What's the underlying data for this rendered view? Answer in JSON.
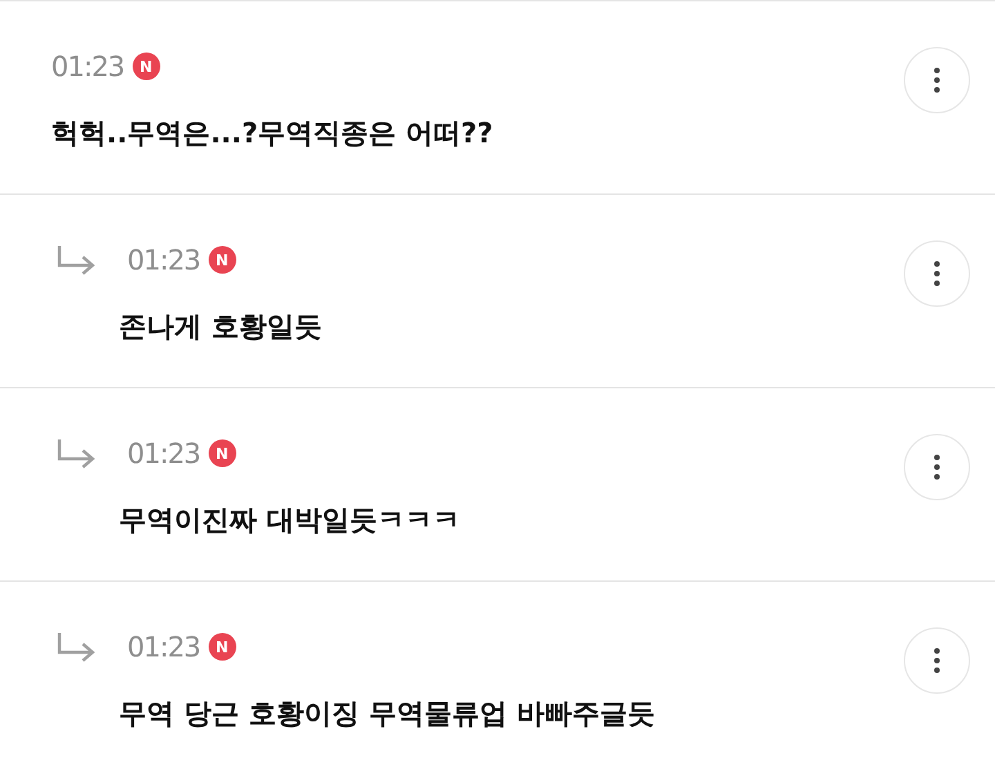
{
  "comments": [
    {
      "time": "01:23",
      "badge": "N",
      "text": "헉헉..무역은...?무역직종은 어떠??",
      "children": [
        {
          "time": "01:23",
          "badge": "N",
          "text": "존나게 호황일듯"
        },
        {
          "time": "01:23",
          "badge": "N",
          "text": "무역이진짜 대박일듯ㅋㅋㅋ"
        },
        {
          "time": "01:23",
          "badge": "N",
          "text": "무역 당근 호황이징 무역물류업 바빠주글듯"
        }
      ]
    }
  ]
}
